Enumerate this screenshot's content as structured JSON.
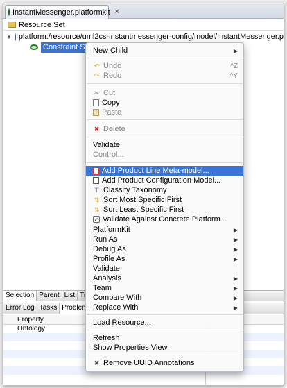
{
  "editor": {
    "tab_label": "InstantMessenger.platformkit",
    "tab_close": "✕",
    "resource_set": "Resource Set",
    "tree_path": "platform:/resource/uml2cs-instantmessenger-config/model/InstantMessenger.platformkit",
    "selected_node": "Constraint Spac"
  },
  "views1": [
    "Selection",
    "Parent",
    "List",
    "Tre"
  ],
  "views2": [
    "Error Log",
    "Tasks",
    "Problems"
  ],
  "properties": {
    "header": "Property",
    "rows": [
      "Ontology"
    ]
  },
  "menu": {
    "new_child": "New Child",
    "undo": "Undo",
    "undo_sc": "^Z",
    "redo": "Redo",
    "redo_sc": "^Y",
    "cut": "Cut",
    "copy": "Copy",
    "paste": "Paste",
    "delete": "Delete",
    "validate": "Validate",
    "control": "Control...",
    "add_product_line": "Add Product Line Meta-model...",
    "add_product_config": "Add Product Configuration Model...",
    "classify": "Classify Taxonomy",
    "sort_most": "Sort Most Specific First",
    "sort_least": "Sort Least Specific First",
    "validate_against": "Validate Against Concrete Platform...",
    "platformkit": "PlatformKit",
    "run_as": "Run As",
    "debug_as": "Debug As",
    "profile_as": "Profile As",
    "validate2": "Validate",
    "analysis": "Analysis",
    "team": "Team",
    "compare_with": "Compare With",
    "replace_with": "Replace With",
    "load_resource": "Load Resource...",
    "refresh": "Refresh",
    "show_properties": "Show Properties View",
    "remove_uuid": "Remove UUID Annotations"
  }
}
